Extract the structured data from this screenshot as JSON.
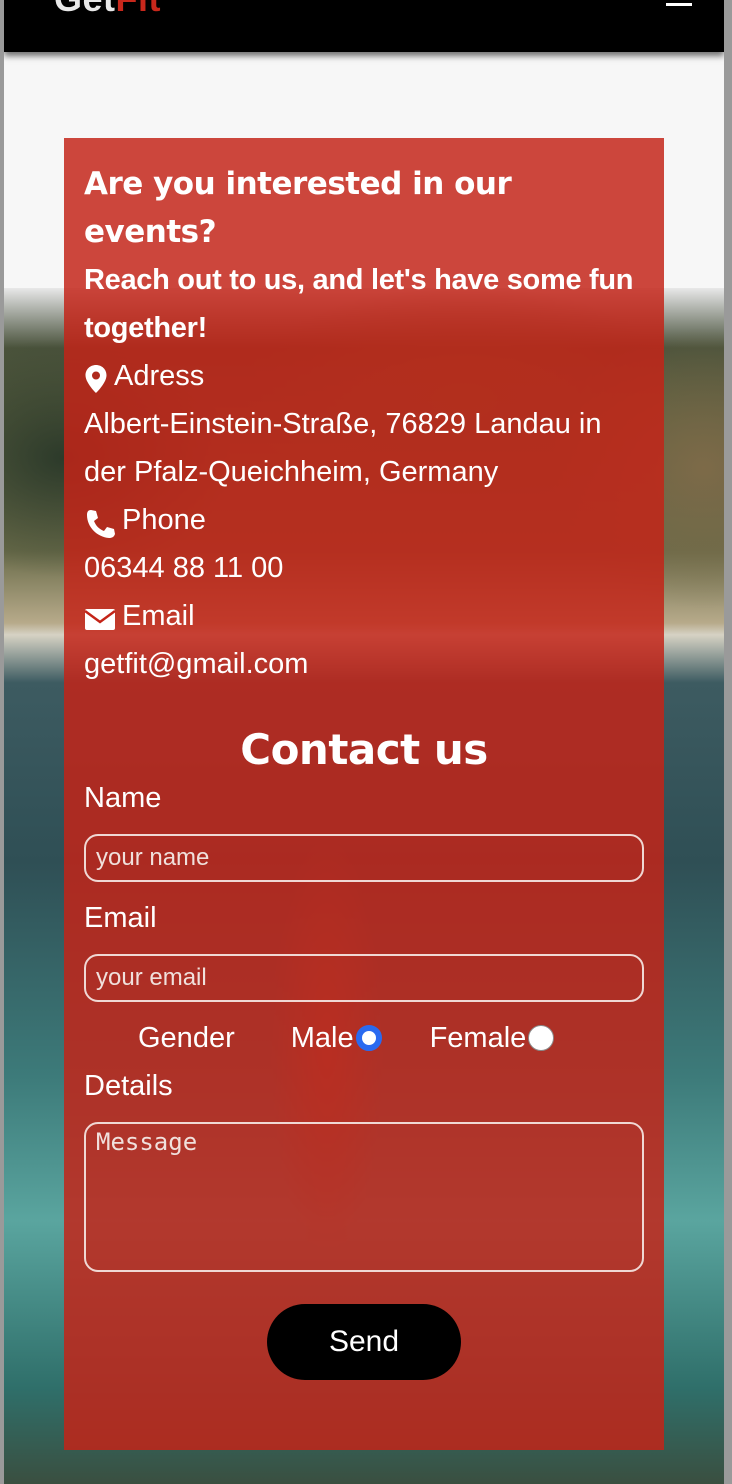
{
  "navbar": {
    "logo_get": "Get",
    "logo_fit": "Fit"
  },
  "contact_info": {
    "heading": "Are you interested in our events?",
    "subheading": "Reach out to us, and let's have some fun together!",
    "address_label": "Adress",
    "address_value": "Albert-Einstein-Straße, 76829 Landau in der Pfalz-Queichheim, Germany",
    "phone_label": "Phone",
    "phone_value": "06344 88 11 00",
    "email_label": "Email",
    "email_value": "getfit@gmail.com",
    "icons": [
      "map-marker-icon",
      "phone-icon",
      "envelope-icon"
    ]
  },
  "form": {
    "title": "Contact us",
    "name_label": "Name",
    "name_placeholder": "your name",
    "email_label": "Email",
    "email_placeholder": "your email",
    "gender_label": "Gender",
    "gender_options": [
      {
        "label": "Male",
        "checked": true
      },
      {
        "label": "Female",
        "checked": false
      }
    ],
    "details_label": "Details",
    "message_placeholder": "Message",
    "send_label": "Send"
  },
  "colors": {
    "panel": "#c42418",
    "navbar": "#000000",
    "logo_accent": "#c8281c",
    "radio_selected": "#2a6af0"
  }
}
